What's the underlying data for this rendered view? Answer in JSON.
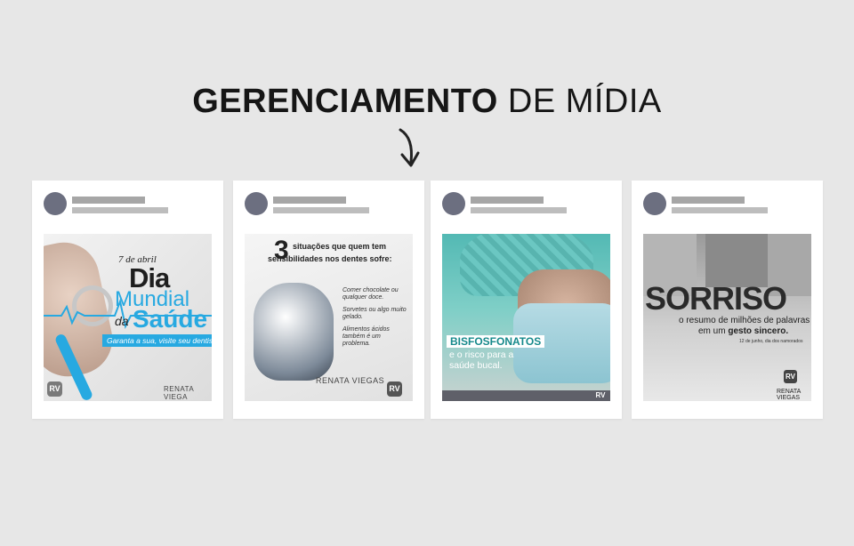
{
  "headline": {
    "bold": "GERENCIAMENTO",
    "light": "DE MÍDIA"
  },
  "posts": [
    {
      "date": "7 de abril",
      "title_1": "Dia",
      "title_2": "Mundial",
      "title_3": "da",
      "title_4": "Saúde",
      "banner": "Garanta a sua, visite seu dentista!",
      "brand": "RENATA VIEGA"
    },
    {
      "num": "3",
      "line_1": "situações que quem tem",
      "line_2": "sensibilidades nos dentes sofre:",
      "items": [
        "Comer chocolate ou qualquer doce.",
        "Sorvetes ou algo muito gelado.",
        "Alimentos ácidos também é um problema."
      ],
      "brand": "RENATA VIEGAS"
    },
    {
      "label": "BISFOSFONATOS",
      "sub": "e o risco para a saúde bucal."
    },
    {
      "word": "SORRISO",
      "line_1": "o resumo de milhões de palavras",
      "line_2a": "em um ",
      "line_2b": "gesto sincero.",
      "date": "12 de junho, dia dos namorados",
      "brand": "RENATA VIEGAS"
    }
  ],
  "logo_glyph": "RV"
}
